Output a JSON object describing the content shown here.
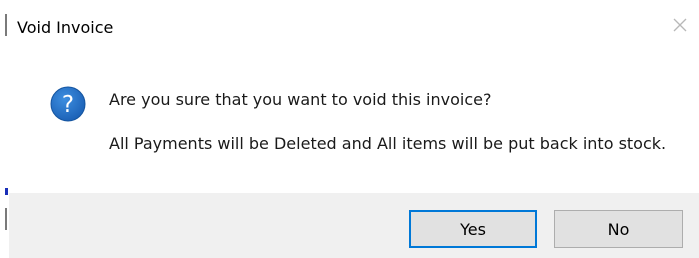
{
  "window": {
    "title": "Void Invoice"
  },
  "message": {
    "question": "Are you sure that you want to void this invoice?",
    "detail": "All Payments will be Deleted and All items will be put back into stock."
  },
  "buttons": {
    "yes_label": "Yes",
    "no_label": "No"
  },
  "icons": {
    "question": "question-icon",
    "close": "close-icon"
  },
  "colors": {
    "icon_blue": "#1e6fc4",
    "default_button_border": "#0078d7",
    "footer_bg": "#f0f0f0"
  }
}
